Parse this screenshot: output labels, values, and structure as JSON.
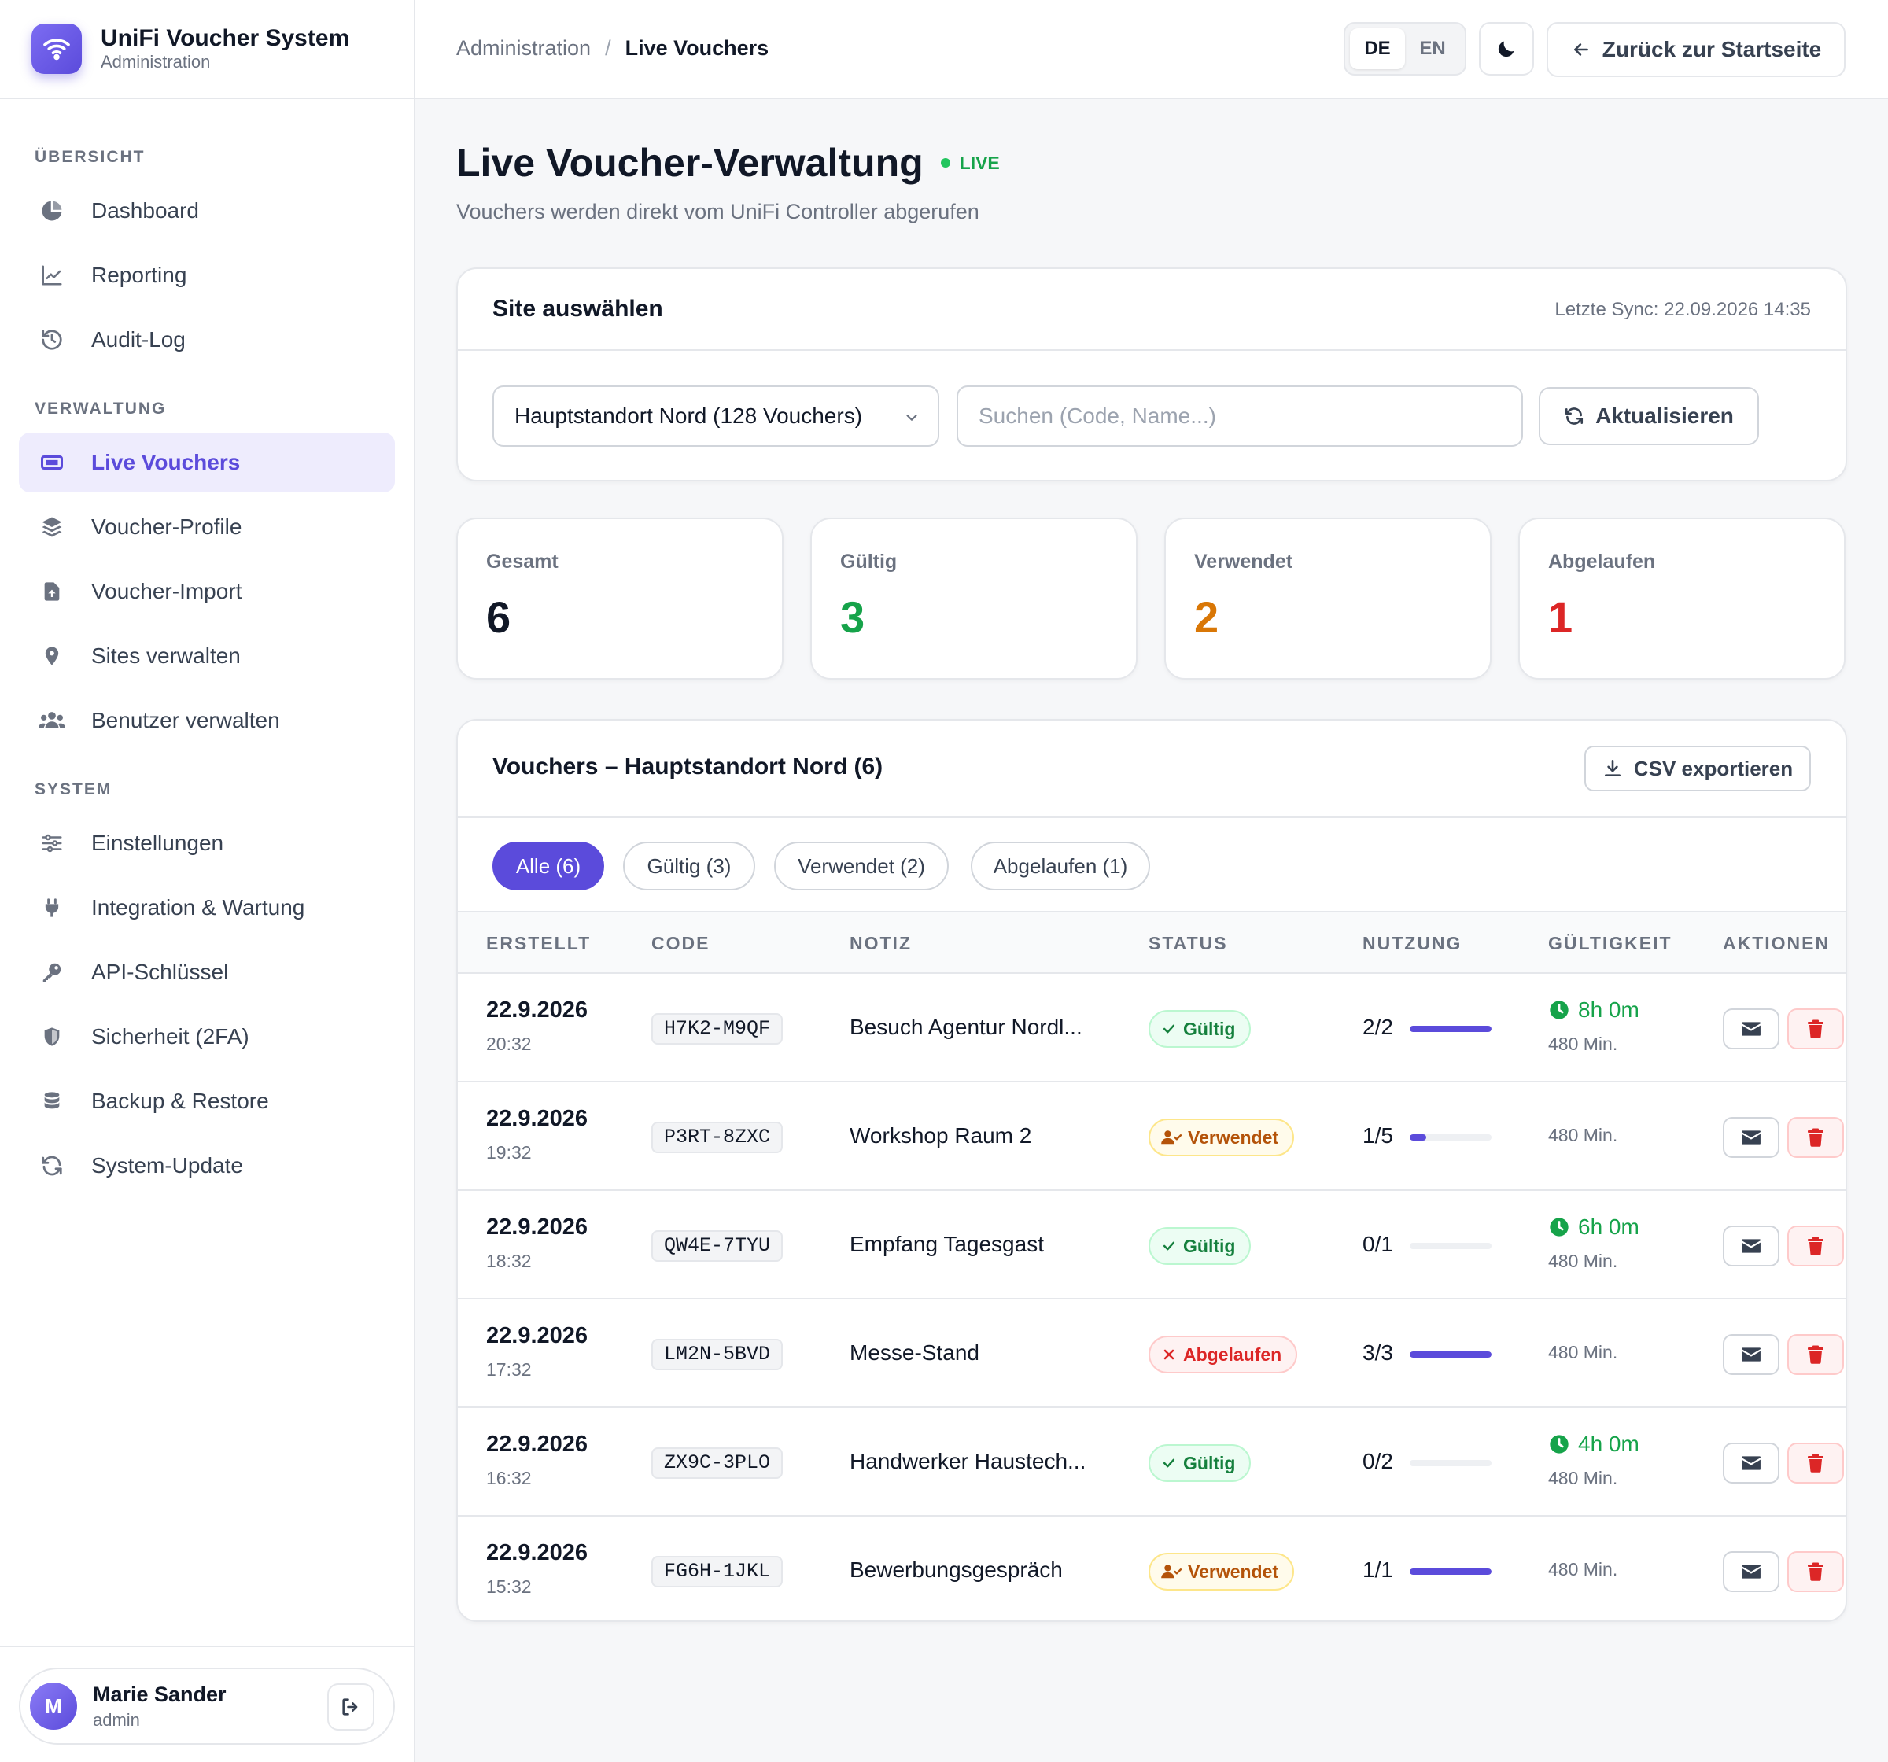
{
  "brand": {
    "title": "UniFi Voucher System",
    "subtitle": "Administration"
  },
  "nav": {
    "sections": [
      {
        "label": "ÜBERSICHT"
      },
      {
        "label": "VERWALTUNG"
      },
      {
        "label": "SYSTEM"
      }
    ],
    "items": [
      {
        "label": "Dashboard",
        "icon": "pie-chart-icon"
      },
      {
        "label": "Reporting",
        "icon": "line-chart-icon"
      },
      {
        "label": "Audit-Log",
        "icon": "history-icon"
      },
      {
        "label": "Live Vouchers",
        "icon": "ticket-icon",
        "active": true
      },
      {
        "label": "Voucher-Profile",
        "icon": "layers-icon"
      },
      {
        "label": "Voucher-Import",
        "icon": "file-upload-icon"
      },
      {
        "label": "Sites verwalten",
        "icon": "map-pin-icon"
      },
      {
        "label": "Benutzer verwalten",
        "icon": "users-icon"
      },
      {
        "label": "Einstellungen",
        "icon": "sliders-icon"
      },
      {
        "label": "Integration & Wartung",
        "icon": "plug-icon"
      },
      {
        "label": "API-Schlüssel",
        "icon": "key-icon"
      },
      {
        "label": "Sicherheit (2FA)",
        "icon": "shield-icon"
      },
      {
        "label": "Backup & Restore",
        "icon": "database-icon"
      },
      {
        "label": "System-Update",
        "icon": "refresh-icon"
      }
    ]
  },
  "user": {
    "initial": "M",
    "name": "Marie Sander",
    "role": "admin"
  },
  "topbar": {
    "breadcrumb_parent": "Administration",
    "breadcrumb_sep": "/",
    "breadcrumb_current": "Live Vouchers",
    "lang_de": "DE",
    "lang_en": "EN",
    "back_label": "Zurück zur Startseite"
  },
  "page": {
    "title": "Live Voucher-Verwaltung",
    "live_label": "LIVE",
    "subtitle": "Vouchers werden direkt vom UniFi Controller abgerufen"
  },
  "site": {
    "title": "Site auswählen",
    "sync": "Letzte Sync: 22.09.2026 14:35",
    "selected": "Hauptstandort Nord (128 Vouchers)",
    "search_placeholder": "Suchen (Code, Name...)",
    "refresh_label": "Aktualisieren"
  },
  "stats": [
    {
      "label": "Gesamt",
      "value": "6",
      "color": "#111827"
    },
    {
      "label": "Gültig",
      "value": "3",
      "color": "#16a34a"
    },
    {
      "label": "Verwendet",
      "value": "2",
      "color": "#d97706"
    },
    {
      "label": "Abgelaufen",
      "value": "1",
      "color": "#dc2626"
    }
  ],
  "table": {
    "title": "Vouchers – Hauptstandort Nord (6)",
    "export_label": "CSV exportieren",
    "filters": [
      "Alle (6)",
      "Gültig (3)",
      "Verwendet (2)",
      "Abgelaufen (1)"
    ],
    "headers": [
      "ERSTELLT",
      "CODE",
      "NOTIZ",
      "STATUS",
      "NUTZUNG",
      "GÜLTIGKEIT",
      "AKTIONEN"
    ],
    "rows": [
      {
        "date": "22.9.2026",
        "time": "20:32",
        "code": "H7K2-M9QF",
        "note": "Besuch Agentur Nordl...",
        "status": "Gültig",
        "status_type": "valid",
        "usage": "2/2",
        "usage_ratio": 1.0,
        "remaining": "8h 0m",
        "minutes": "480 Min."
      },
      {
        "date": "22.9.2026",
        "time": "19:32",
        "code": "P3RT-8ZXC",
        "note": "Workshop Raum 2",
        "status": "Verwendet",
        "status_type": "used",
        "usage": "1/5",
        "usage_ratio": 0.2,
        "remaining": "",
        "minutes": "480 Min."
      },
      {
        "date": "22.9.2026",
        "time": "18:32",
        "code": "QW4E-7TYU",
        "note": "Empfang Tagesgast",
        "status": "Gültig",
        "status_type": "valid",
        "usage": "0/1",
        "usage_ratio": 0,
        "remaining": "6h 0m",
        "minutes": "480 Min."
      },
      {
        "date": "22.9.2026",
        "time": "17:32",
        "code": "LM2N-5BVD",
        "note": "Messe-Stand",
        "status": "Abgelaufen",
        "status_type": "expired",
        "usage": "3/3",
        "usage_ratio": 1.0,
        "remaining": "",
        "minutes": "480 Min."
      },
      {
        "date": "22.9.2026",
        "time": "16:32",
        "code": "ZX9C-3PLO",
        "note": "Handwerker Haustech...",
        "status": "Gültig",
        "status_type": "valid",
        "usage": "0/2",
        "usage_ratio": 0,
        "remaining": "4h 0m",
        "minutes": "480 Min."
      },
      {
        "date": "22.9.2026",
        "time": "15:32",
        "code": "FG6H-1JKL",
        "note": "Bewerbungsgespräch",
        "status": "Verwendet",
        "status_type": "used",
        "usage": "1/1",
        "usage_ratio": 1.0,
        "remaining": "",
        "minutes": "480 Min."
      }
    ]
  }
}
